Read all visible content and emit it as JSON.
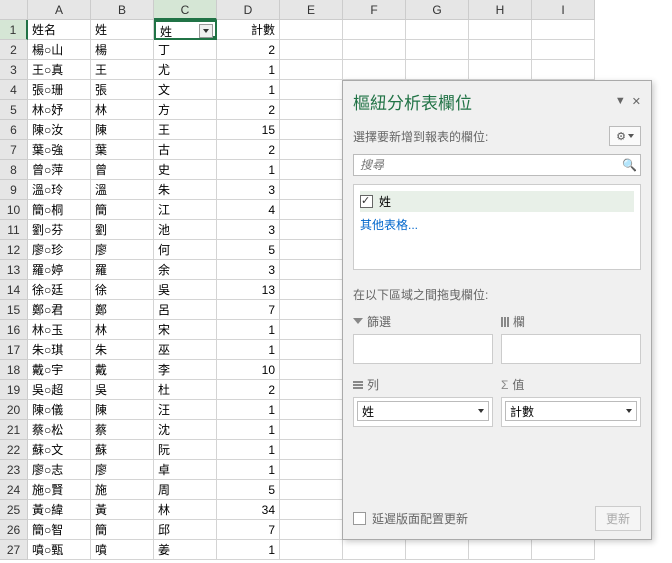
{
  "columns": [
    "A",
    "B",
    "C",
    "D",
    "E",
    "F",
    "G",
    "H",
    "I"
  ],
  "selected_cell": {
    "row": 1,
    "col": 3
  },
  "rows": [
    {
      "n": 1,
      "a": "姓名",
      "b": "姓",
      "c": "姓",
      "d": "計數"
    },
    {
      "n": 2,
      "a": "楊○山",
      "b": "楊",
      "c": "丁",
      "d": "2"
    },
    {
      "n": 3,
      "a": "王○真",
      "b": "王",
      "c": "尤",
      "d": "1"
    },
    {
      "n": 4,
      "a": "張○珊",
      "b": "張",
      "c": "文",
      "d": "1"
    },
    {
      "n": 5,
      "a": "林○妤",
      "b": "林",
      "c": "方",
      "d": "2"
    },
    {
      "n": 6,
      "a": "陳○汝",
      "b": "陳",
      "c": "王",
      "d": "15"
    },
    {
      "n": 7,
      "a": "葉○強",
      "b": "葉",
      "c": "古",
      "d": "2"
    },
    {
      "n": 8,
      "a": "曾○萍",
      "b": "曾",
      "c": "史",
      "d": "1"
    },
    {
      "n": 9,
      "a": "溫○玲",
      "b": "溫",
      "c": "朱",
      "d": "3"
    },
    {
      "n": 10,
      "a": "簡○桐",
      "b": "簡",
      "c": "江",
      "d": "4"
    },
    {
      "n": 11,
      "a": "劉○芬",
      "b": "劉",
      "c": "池",
      "d": "3"
    },
    {
      "n": 12,
      "a": "廖○珍",
      "b": "廖",
      "c": "何",
      "d": "5"
    },
    {
      "n": 13,
      "a": "羅○婷",
      "b": "羅",
      "c": "余",
      "d": "3"
    },
    {
      "n": 14,
      "a": "徐○廷",
      "b": "徐",
      "c": "吳",
      "d": "13"
    },
    {
      "n": 15,
      "a": "鄭○君",
      "b": "鄭",
      "c": "呂",
      "d": "7"
    },
    {
      "n": 16,
      "a": "林○玉",
      "b": "林",
      "c": "宋",
      "d": "1"
    },
    {
      "n": 17,
      "a": "朱○琪",
      "b": "朱",
      "c": "巫",
      "d": "1"
    },
    {
      "n": 18,
      "a": "戴○宇",
      "b": "戴",
      "c": "李",
      "d": "10"
    },
    {
      "n": 19,
      "a": "吳○超",
      "b": "吳",
      "c": "杜",
      "d": "2"
    },
    {
      "n": 20,
      "a": "陳○儀",
      "b": "陳",
      "c": "汪",
      "d": "1"
    },
    {
      "n": 21,
      "a": "蔡○松",
      "b": "蔡",
      "c": "沈",
      "d": "1"
    },
    {
      "n": 22,
      "a": "蘇○文",
      "b": "蘇",
      "c": "阮",
      "d": "1"
    },
    {
      "n": 23,
      "a": "廖○志",
      "b": "廖",
      "c": "卓",
      "d": "1"
    },
    {
      "n": 24,
      "a": "施○賢",
      "b": "施",
      "c": "周",
      "d": "5"
    },
    {
      "n": 25,
      "a": "黃○緯",
      "b": "黃",
      "c": "林",
      "d": "34"
    },
    {
      "n": 26,
      "a": "簡○智",
      "b": "簡",
      "c": "邱",
      "d": "7"
    },
    {
      "n": 27,
      "a": "噴○甄",
      "b": "噴",
      "c": "姜",
      "d": "1"
    }
  ],
  "panel": {
    "title": "樞紐分析表欄位",
    "choose_label": "選擇要新增到報表的欄位:",
    "search_placeholder": "搜尋",
    "field_name": "姓",
    "other_tables": "其他表格...",
    "drag_label": "在以下區域之間拖曳欄位:",
    "areas": {
      "filter": "篩選",
      "columns": "欄",
      "rows": "列",
      "values": "值"
    },
    "row_field": "姓",
    "value_field": "計數",
    "defer": "延遲版面配置更新",
    "update": "更新"
  }
}
